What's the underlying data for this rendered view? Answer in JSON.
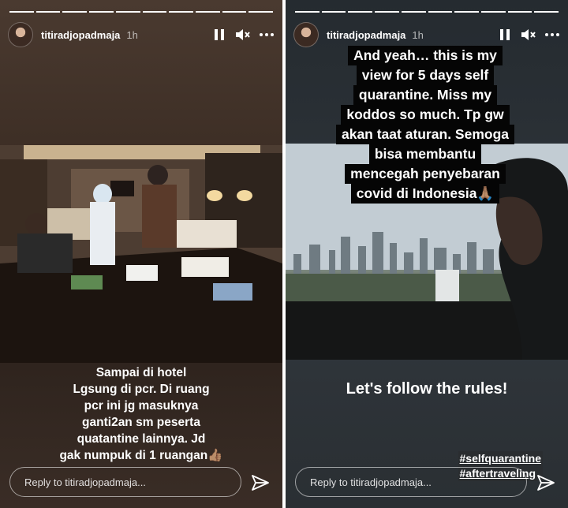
{
  "stories": [
    {
      "username": "titiradjopadmaja",
      "time_ago": "1h",
      "caption_lines": [
        "Sampai di hotel",
        "Lgsung di pcr. Di ruang",
        "pcr ini jg masuknya",
        "ganti2an sm peserta",
        "quatantine lainnya. Jd",
        "gak numpuk di 1 ruangan👍🏽"
      ],
      "reply_placeholder": "Reply to titiradjopadmaja...",
      "progress": {
        "total": 10,
        "current": 10
      }
    },
    {
      "username": "titiradjopadmaja",
      "time_ago": "1h",
      "overlay_lines": [
        "And yeah… this is my",
        "view for 5 days self",
        "quarantine. Miss my",
        "koddos so much. Tp gw",
        "akan taat aturan. Semoga",
        "bisa membantu",
        "mencegah penyebaran",
        "covid di Indonesia🙏🏽"
      ],
      "rules_text": "Let's follow the rules!",
      "hashtags": [
        "#selfquarantine",
        "#aftertraveling"
      ],
      "reply_placeholder": "Reply to titiradjopadmaja...",
      "progress": {
        "total": 10,
        "current": 10
      }
    }
  ],
  "icons": {
    "pause": "pause-icon",
    "mute": "speaker-muted-icon",
    "more": "more-dots-icon",
    "send": "paper-plane-icon"
  },
  "colors": {
    "story1_bg": "#3d2e25",
    "story2_bg": "#30363c",
    "overlay_text_bg": "#050505",
    "text": "#ffffff"
  }
}
